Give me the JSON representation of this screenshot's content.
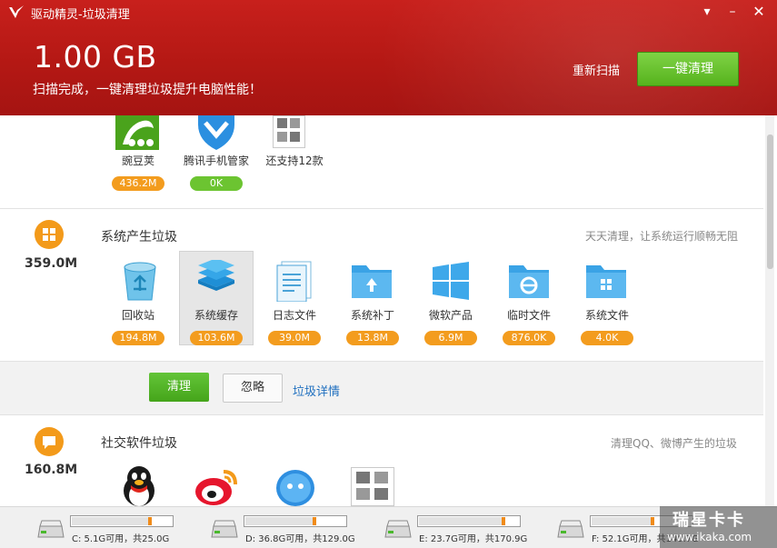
{
  "window": {
    "title": "驱动精灵-垃圾清理"
  },
  "header": {
    "total_size": "1.00 GB",
    "status": "扫描完成，一键清理垃圾提升电脑性能！",
    "rescan_label": "重新扫描",
    "clean_all_label": "一键清理"
  },
  "apps_top": [
    {
      "name": "豌豆荚",
      "size": "436.2M",
      "badge_color": "#f39c1e"
    },
    {
      "name": "腾讯手机管家",
      "size": "0K",
      "badge_color": "#6cc431"
    },
    {
      "name": "还支持12款",
      "size": ""
    }
  ],
  "system_junk": {
    "title": "系统产生垃圾",
    "total": "359.0M",
    "description": "天天清理，让系统运行顺畅无阻",
    "items": [
      {
        "name": "回收站",
        "size": "194.8M",
        "icon": "recycle-bin-icon"
      },
      {
        "name": "系统缓存",
        "size": "103.6M",
        "icon": "layers-icon",
        "selected": true
      },
      {
        "name": "日志文件",
        "size": "39.0M",
        "icon": "log-file-icon"
      },
      {
        "name": "系统补丁",
        "size": "13.8M",
        "icon": "folder-upload-icon"
      },
      {
        "name": "微软产品",
        "size": "6.9M",
        "icon": "windows-logo-icon"
      },
      {
        "name": "临时文件",
        "size": "876.0K",
        "icon": "folder-ie-icon"
      },
      {
        "name": "系统文件",
        "size": "4.0K",
        "icon": "folder-windows-icon"
      }
    ],
    "actions": {
      "clean_label": "清理",
      "ignore_label": "忽略",
      "detail_label": "垃圾详情"
    }
  },
  "social_junk": {
    "title": "社交软件垃圾",
    "total": "160.8M",
    "description": "清理QQ、微博产生的垃圾",
    "apps": [
      "qq-penguin-icon",
      "weibo-icon",
      "chat-bubble-icon",
      "more-apps-icon"
    ]
  },
  "drives": [
    {
      "label": "C: 5.1G可用，共25.0G",
      "used_fraction": 0.8
    },
    {
      "label": "D: 36.8G可用，共129.0G",
      "used_fraction": 0.71
    },
    {
      "label": "E: 23.7G可用，共170.9G",
      "used_fraction": 0.86
    },
    {
      "label": "F: 52.1G可用，共140.7G",
      "used_fraction": 0.63
    }
  ],
  "watermark": {
    "line1": "瑞星卡卡",
    "line2": "www.ikaka.com"
  },
  "colors": {
    "header_red": "#b41814",
    "accent_orange": "#f39c1e",
    "accent_green": "#56b31d",
    "link_blue": "#1f6fbf"
  }
}
